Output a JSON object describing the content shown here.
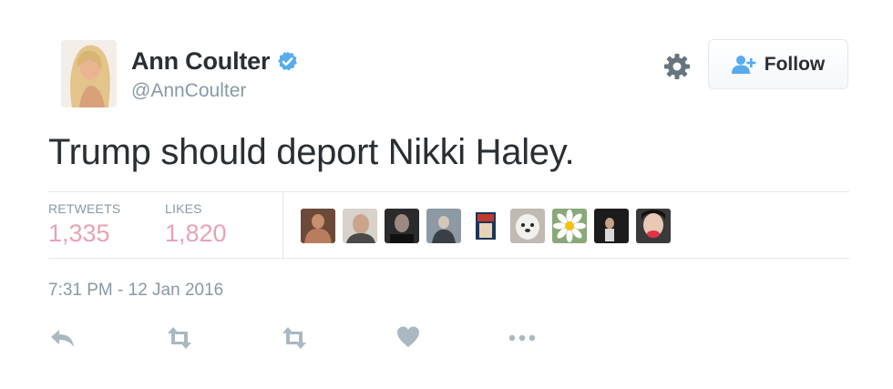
{
  "author": {
    "name": "Ann Coulter",
    "handle": "@AnnCoulter",
    "verified_icon": "verified-badge-icon"
  },
  "header": {
    "settings_icon": "gear-icon",
    "follow_label": "Follow",
    "follow_icon": "follow-user-icon"
  },
  "tweet": {
    "text": "Trump should deport Nikki Haley."
  },
  "stats": {
    "retweets_label": "RETWEETS",
    "retweets_value": "1,335",
    "likes_label": "LIKES",
    "likes_value": "1,820"
  },
  "likers": [
    {
      "name": "liker-avatar-1"
    },
    {
      "name": "liker-avatar-2"
    },
    {
      "name": "liker-avatar-3"
    },
    {
      "name": "liker-avatar-4"
    },
    {
      "name": "liker-avatar-5"
    },
    {
      "name": "liker-avatar-6"
    },
    {
      "name": "liker-avatar-7"
    },
    {
      "name": "liker-avatar-8"
    },
    {
      "name": "liker-avatar-9"
    }
  ],
  "timestamp": "7:31 PM - 12 Jan 2016",
  "actions": [
    "reply-icon",
    "retweet-icon",
    "retweet-icon",
    "like-heart-icon",
    "more-options-icon"
  ],
  "colors": {
    "text": "#292f33",
    "muted": "#8899a6",
    "stat_value": "#e8a3b3",
    "border": "#e1e8ed",
    "verified": "#55acee",
    "action_icon": "#aab8c2"
  }
}
